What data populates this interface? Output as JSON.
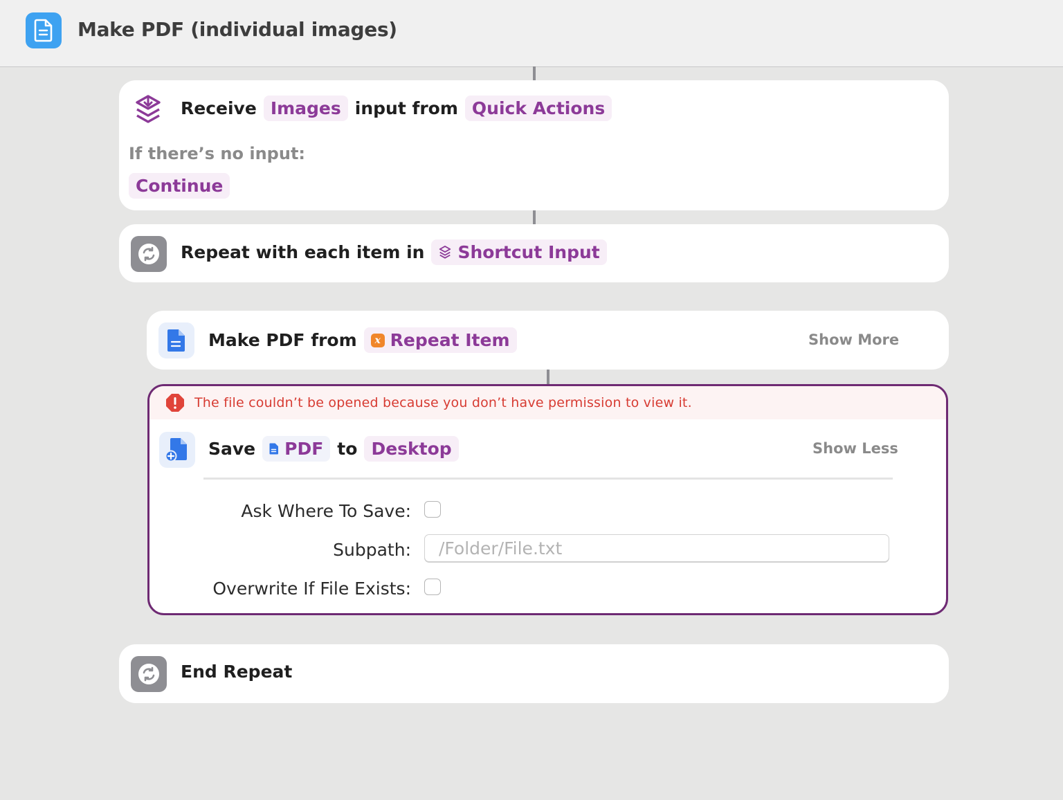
{
  "window": {
    "title": "Make PDF (individual images)"
  },
  "receive": {
    "verb": "Receive",
    "type_token": "Images",
    "mid": "input from",
    "source_token": "Quick Actions",
    "no_input_label": "If there’s no input:",
    "no_input_token": "Continue"
  },
  "repeat": {
    "label": "Repeat with each item in",
    "token": "Shortcut Input"
  },
  "make_pdf": {
    "label": "Make PDF from",
    "token": "Repeat Item",
    "show_more": "Show More"
  },
  "save": {
    "error": "The file couldn’t be opened because you don’t have permission to view it.",
    "verb": "Save",
    "file_token": "PDF",
    "mid": "to",
    "dest_token": "Desktop",
    "show_less": "Show Less",
    "ask_label": "Ask Where To Save:",
    "subpath_label": "Subpath:",
    "subpath_placeholder": "/Folder/File.txt",
    "subpath_value": "",
    "overwrite_label": "Overwrite If File Exists:",
    "ask_checked": false,
    "overwrite_checked": false
  },
  "end_repeat": {
    "label": "End Repeat"
  },
  "colors": {
    "accent_purple": "#8c3a98",
    "token_bg": "#f7eef7",
    "error_red": "#d73b32",
    "error_border": "#6e2a73",
    "app_blue": "#3ea2f1"
  },
  "icons": {
    "app": "document-icon",
    "receive": "stack-download-icon",
    "repeat": "repeat-arrows-icon",
    "make_pdf": "pdf-document-icon",
    "save": "save-document-icon",
    "error": "stop-exclamation-icon",
    "variable": "variable-x-icon"
  }
}
